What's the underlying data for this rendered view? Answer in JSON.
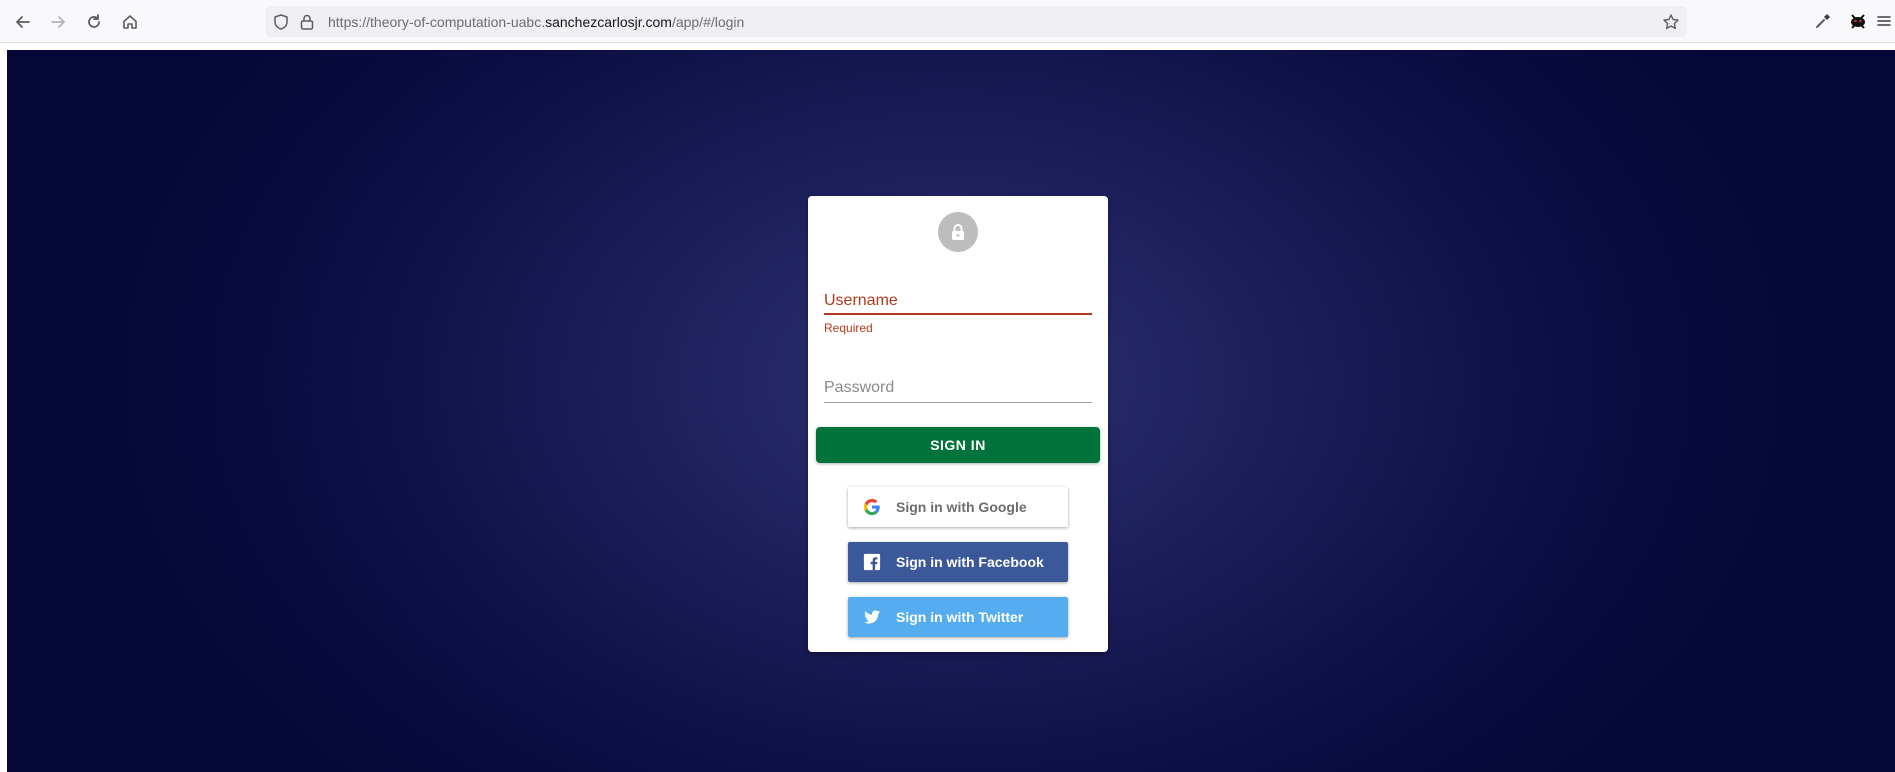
{
  "browser": {
    "url_prefix": "https://theory-of-computation-uabc.",
    "url_domain": "sanchezcarlosjr.com",
    "url_suffix": "/app/#/login",
    "icons": [
      "back-arrow-icon",
      "forward-arrow-icon",
      "reload-icon",
      "home-icon",
      "shield-icon",
      "lock-icon",
      "star-icon",
      "eyedropper-icon",
      "extension-icon",
      "menu-icon"
    ]
  },
  "login": {
    "avatar_icon": "lock-icon",
    "username": {
      "label": "Username",
      "helper": "Required",
      "value": ""
    },
    "password": {
      "label": "Password",
      "value": ""
    },
    "signin_label": "SIGN IN",
    "google_label": "Sign in with Google",
    "facebook_label": "Sign in with Facebook",
    "twitter_label": "Sign in with Twitter"
  },
  "colors": {
    "background": "#0b0d44",
    "primary_button": "#00733a",
    "error": "#b23a1a",
    "facebook": "#3b5998",
    "twitter": "#55acee"
  }
}
